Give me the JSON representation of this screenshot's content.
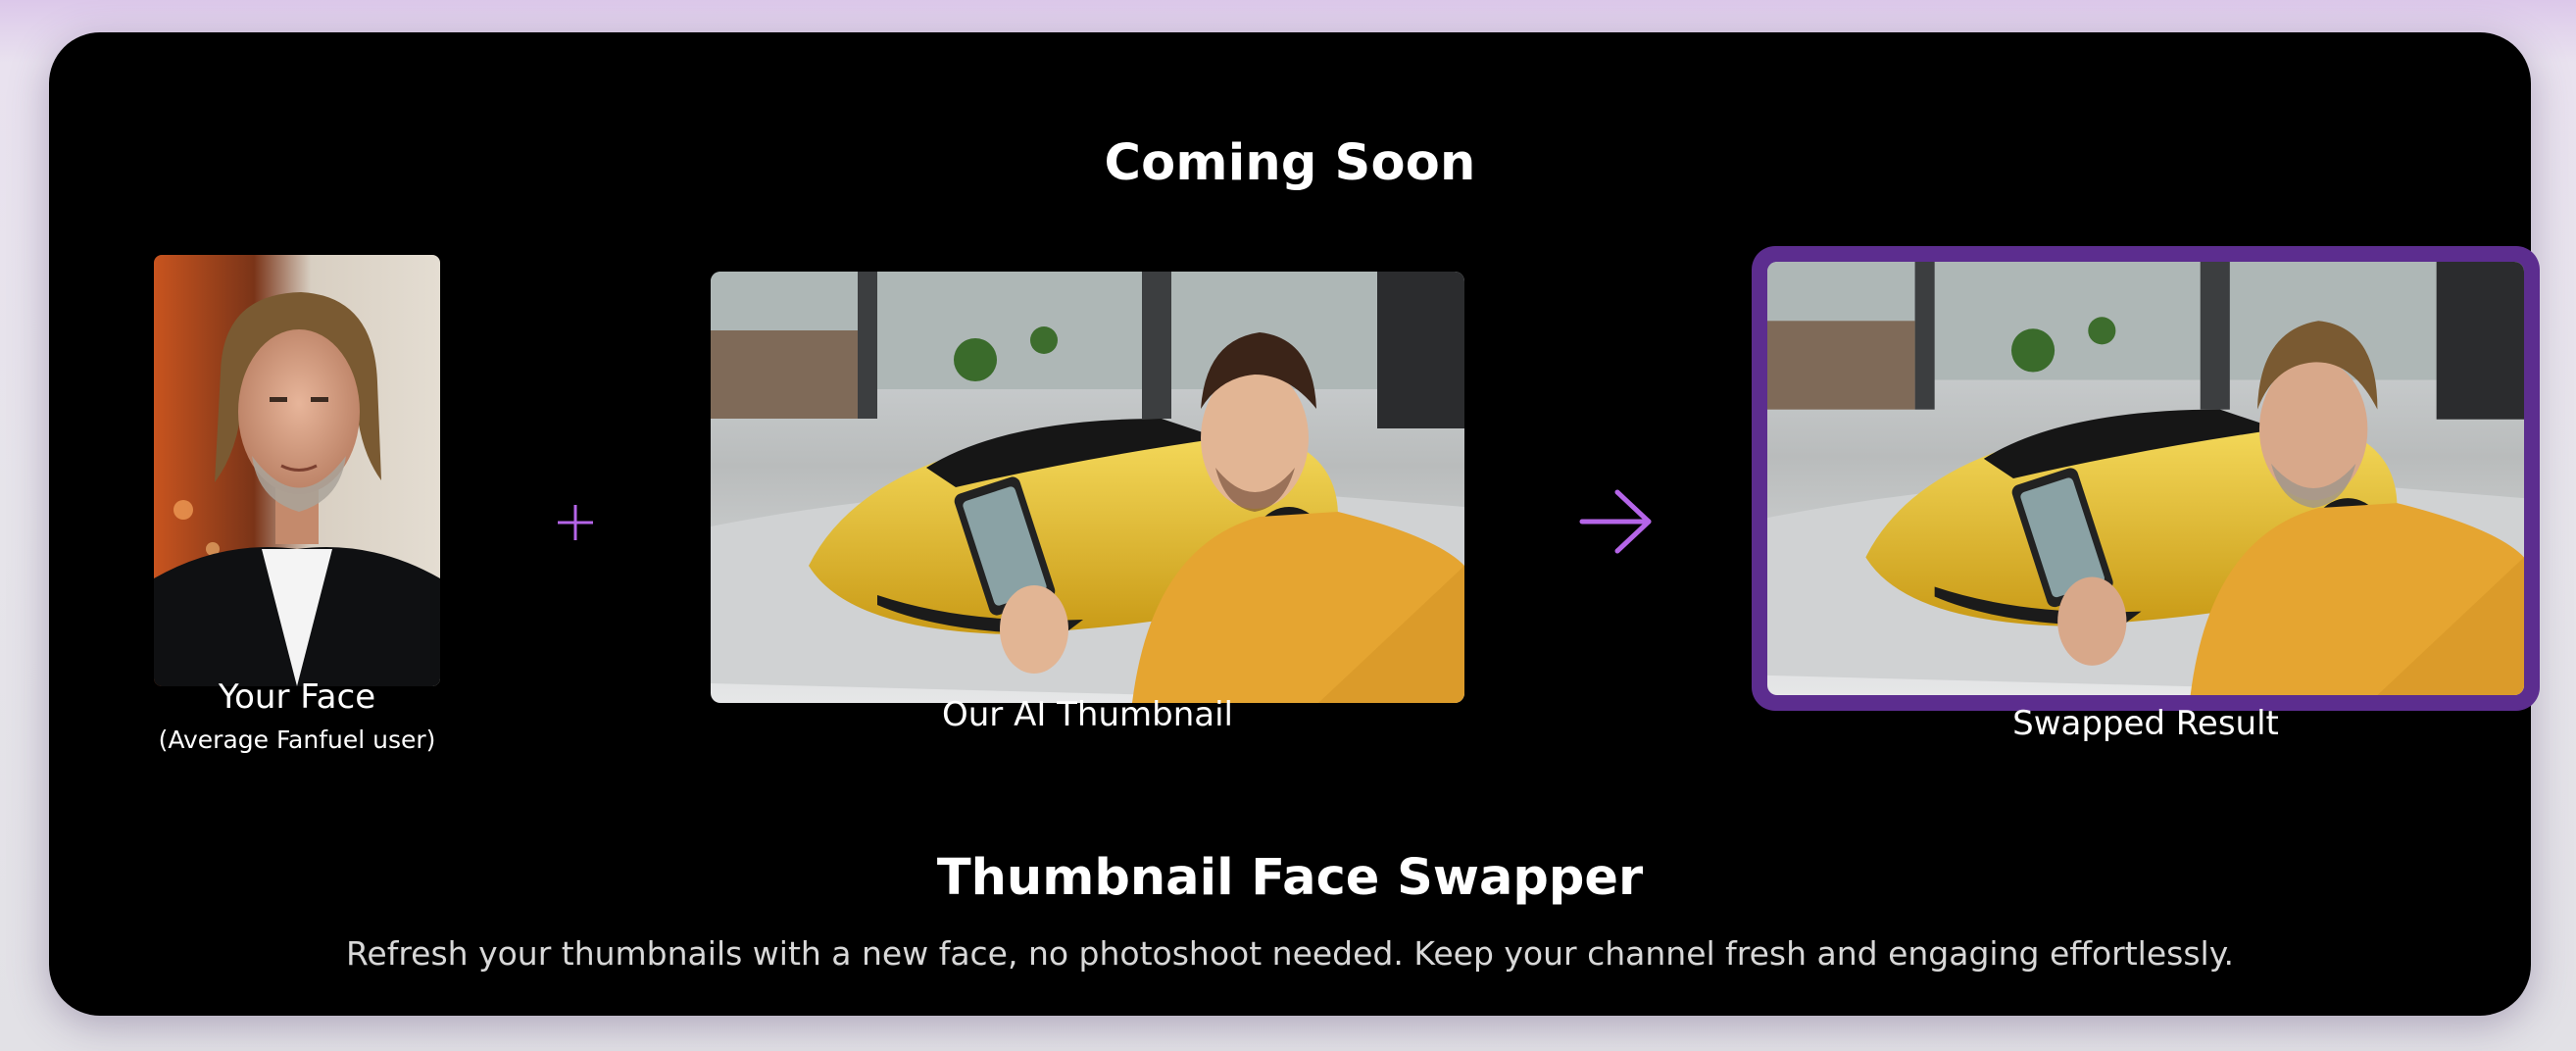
{
  "section": {
    "heading": "Coming Soon",
    "face": {
      "label": "Your Face",
      "sublabel": "(Average Fanfuel user)"
    },
    "thumbnail": {
      "label": "Our AI Thumbnail"
    },
    "result": {
      "label": "Swapped Result"
    },
    "feature_title": "Thumbnail Face Swapper",
    "feature_description": "Refresh your thumbnails with a new face, no photoshoot needed. Keep your channel fresh and engaging effortlessly."
  },
  "icons": {
    "plus": "plus-icon",
    "arrow": "arrow-right-icon"
  },
  "colors": {
    "card_background": "#000000",
    "accent": "#b565e8",
    "result_border": "#5c2d8f"
  }
}
